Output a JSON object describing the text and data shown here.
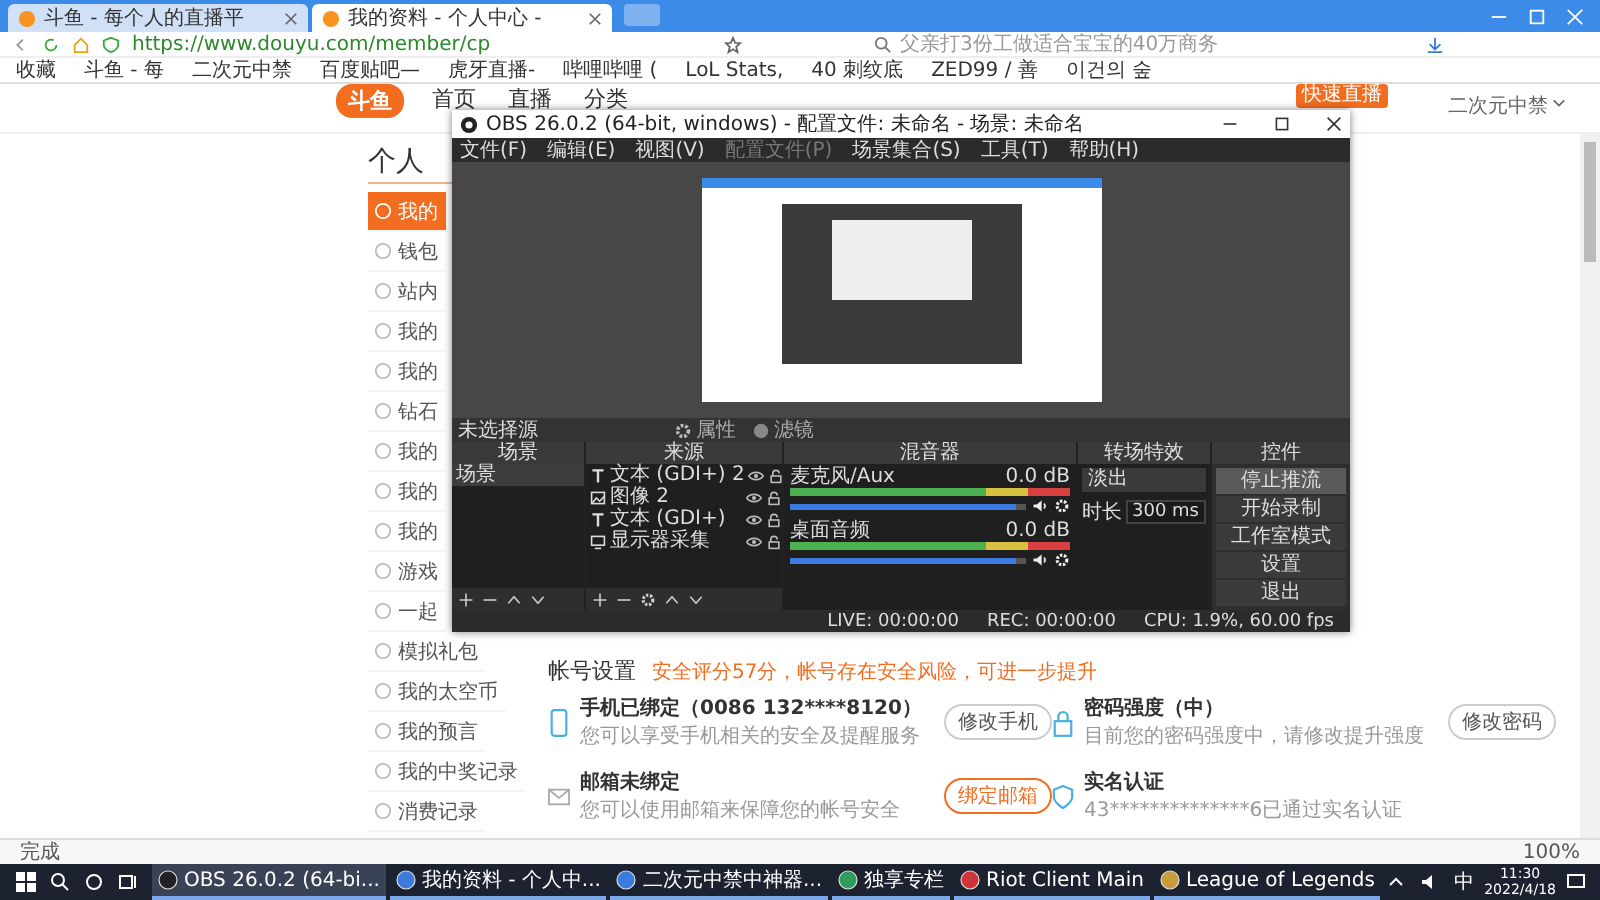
{
  "browser": {
    "tabs": [
      {
        "title": "斗鱼 - 每个人的直播平",
        "selected": false
      },
      {
        "title": "我的资料 - 个人中心 -",
        "selected": true
      }
    ],
    "url": "https://www.douyu.com/member/cp",
    "search": {
      "placeholder": "父亲打3份工做适合宝宝的40万商务"
    },
    "bookmarks": [
      "收藏",
      "斗鱼 - 每",
      "二次元中禁",
      "百度贴吧—",
      "虎牙直播-",
      "哔哩哔哩 (",
      "LoL Stats,",
      "40 刺纹底",
      "ZED99 / 善",
      "이건의 숲"
    ],
    "status_text": "完成",
    "zoom": "100%"
  },
  "site": {
    "logo": "斗鱼",
    "nav": [
      "首页",
      "直播",
      "分类"
    ],
    "live_badge": "快速直播",
    "user": "二次元中禁"
  },
  "sidebar": {
    "title": "个人",
    "items": [
      {
        "label": "我的",
        "selected": true
      },
      {
        "label": "钱包",
        "selected": false
      },
      {
        "label": "站内",
        "selected": false
      },
      {
        "label": "我的",
        "selected": false
      },
      {
        "label": "我的",
        "selected": false
      },
      {
        "label": "钻石",
        "selected": false
      },
      {
        "label": "我的",
        "selected": false
      },
      {
        "label": "我的",
        "selected": false
      },
      {
        "label": "我的",
        "selected": false
      },
      {
        "label": "游戏",
        "selected": false
      },
      {
        "label": "一起",
        "selected": false
      },
      {
        "label": "模拟礼包",
        "selected": false
      },
      {
        "label": "我的太空币",
        "selected": false
      },
      {
        "label": "我的预言",
        "selected": false
      },
      {
        "label": "我的中奖记录",
        "selected": false
      },
      {
        "label": "消费记录",
        "selected": false
      }
    ]
  },
  "account": {
    "title": "帐号设置",
    "warning": "安全评分57分，帐号存在安全风险，可进一步提升",
    "cards": [
      {
        "kind": "phone",
        "title": "手机已绑定（0086 132****8120）",
        "text": "您可以享受手机相关的安全及提醒服务",
        "button": "修改手机",
        "emphasis": false
      },
      {
        "kind": "lock",
        "title": "密码强度（中）",
        "text": "目前您的密码强度中，请修改提升强度",
        "button": "修改密码",
        "emphasis": false
      },
      {
        "kind": "mail",
        "title": "邮箱未绑定",
        "text": "您可以使用邮箱来保障您的帐号安全",
        "button": "绑定邮箱",
        "emphasis": true
      },
      {
        "kind": "shield",
        "title": "实名认证",
        "text": "43**************6已通过实名认证"
      }
    ]
  },
  "obs": {
    "title": "OBS 26.0.2 (64-bit, windows) - 配置文件: 未命名 - 场景: 未命名",
    "menu": [
      {
        "label": "文件(F)",
        "disabled": false
      },
      {
        "label": "编辑(E)",
        "disabled": false
      },
      {
        "label": "视图(V)",
        "disabled": false
      },
      {
        "label": "配置文件(P)",
        "disabled": true
      },
      {
        "label": "场景集合(S)",
        "disabled": false
      },
      {
        "label": "工具(T)",
        "disabled": false
      },
      {
        "label": "帮助(H)",
        "disabled": false
      }
    ],
    "source_bar": {
      "label": "未选择源",
      "properties": "属性",
      "filters": "滤镜"
    },
    "scenes": {
      "title": "场景",
      "items": [
        {
          "label": "场景",
          "selected": true
        }
      ]
    },
    "sources": {
      "title": "来源",
      "items": [
        {
          "kind": "text",
          "label": "文本 (GDI+) 2"
        },
        {
          "kind": "image",
          "label": "图像 2"
        },
        {
          "kind": "text",
          "label": "文本 (GDI+)"
        },
        {
          "kind": "display",
          "label": "显示器采集"
        }
      ]
    },
    "mixer": {
      "title": "混音器",
      "tracks": [
        {
          "name": "麦克风/Aux",
          "reading": "0.0 dB",
          "level": 0.96
        },
        {
          "name": "桌面音频",
          "reading": "0.0 dB",
          "level": 0.96
        }
      ]
    },
    "transitions": {
      "title": "转场特效",
      "type": "淡出",
      "duration_label": "时长",
      "duration": "300 ms"
    },
    "controls": {
      "title": "控件",
      "buttons": [
        {
          "label": "停止推流",
          "selected": true
        },
        {
          "label": "开始录制",
          "selected": false
        },
        {
          "label": "工作室模式",
          "selected": false
        },
        {
          "label": "设置",
          "selected": false
        },
        {
          "label": "退出",
          "selected": false
        }
      ]
    },
    "status": {
      "live": "LIVE: 00:00:00",
      "rec": "REC: 00:00:00",
      "cpu": "CPU: 1.9%, 60.00 fps"
    }
  },
  "taskbar": {
    "items": [
      {
        "label": "OBS 26.0.2 (64-bi...",
        "selected": true
      },
      {
        "label": "我的资料 - 个人中...",
        "selected": false
      },
      {
        "label": "二次元中禁中神器...",
        "selected": false
      },
      {
        "label": "独享专栏",
        "selected": false
      },
      {
        "label": "Riot Client Main",
        "selected": false
      },
      {
        "label": "League of Legends",
        "selected": false
      }
    ],
    "ime": "中",
    "time": "11:30",
    "date": "2022/4/18"
  }
}
